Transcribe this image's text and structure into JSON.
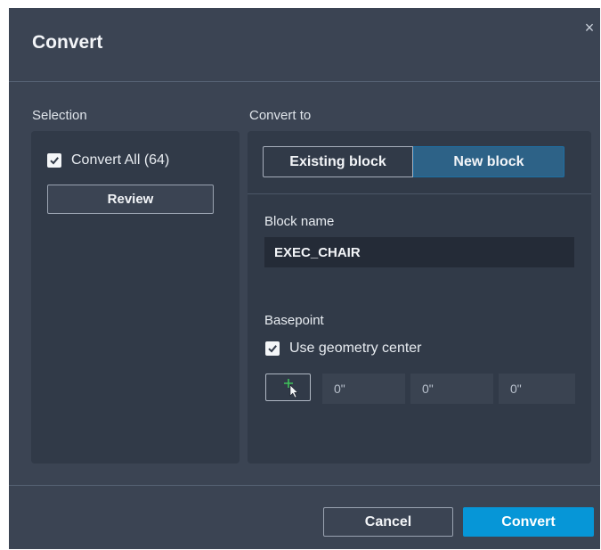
{
  "dialog": {
    "title": "Convert",
    "close_label": "×"
  },
  "selection": {
    "label": "Selection",
    "convert_all_label": "Convert All (64)",
    "convert_all_checked": true,
    "review_label": "Review"
  },
  "convert_to": {
    "label": "Convert to",
    "options": [
      "Existing block",
      "New block"
    ],
    "selected": "New block",
    "block_name_label": "Block name",
    "block_name_value": "EXEC_CHAIR",
    "basepoint_label": "Basepoint",
    "use_geometry_center_label": "Use geometry center",
    "use_geometry_center_checked": true,
    "coords": [
      "0\"",
      "0\"",
      "0\""
    ]
  },
  "footer": {
    "cancel_label": "Cancel",
    "convert_label": "Convert"
  },
  "colors": {
    "background": "#3b4453",
    "panel": "#313a48",
    "accent": "#0696d7",
    "selected_segment": "#2d6287",
    "pick_icon_plus": "#3fc25a"
  },
  "icons": {
    "close": "close-icon",
    "checkbox": "checkmark-icon",
    "pick_point": "pick-point-icon"
  }
}
